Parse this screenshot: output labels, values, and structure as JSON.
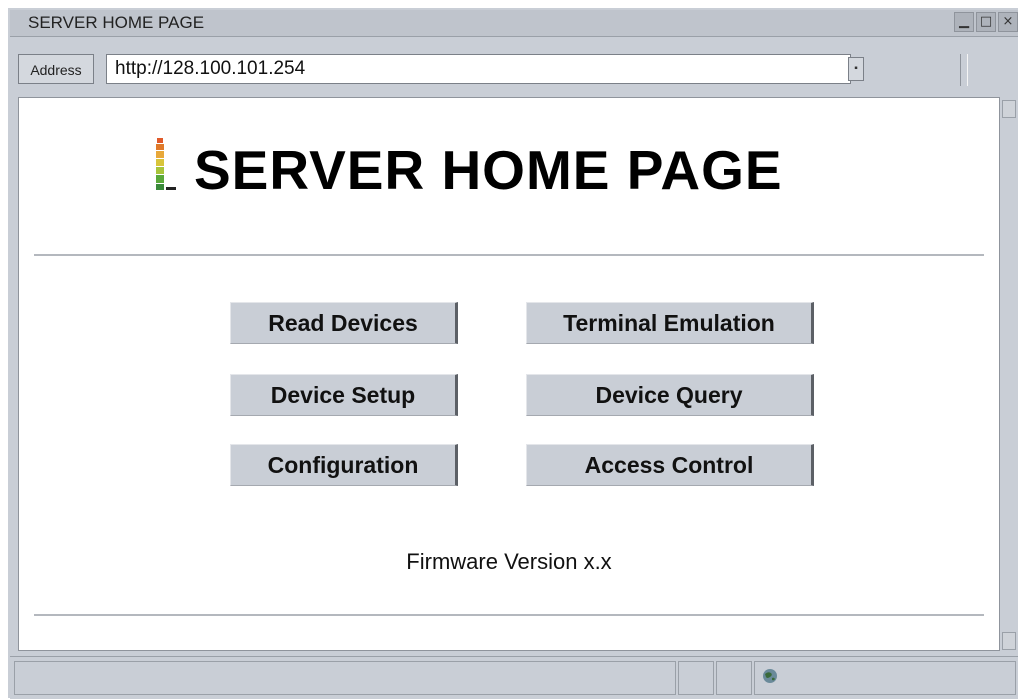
{
  "window": {
    "title": "SERVER HOME PAGE"
  },
  "address_bar": {
    "label": "Address",
    "url": "http://128.100.101.254"
  },
  "page": {
    "title": "SERVER HOME PAGE",
    "buttons": {
      "read_devices": "Read Devices",
      "terminal_emulation": "Terminal Emulation",
      "device_setup": "Device Setup",
      "device_query": "Device Query",
      "configuration": "Configuration",
      "access_control": "Access Control"
    },
    "firmware": "Firmware Version x.x"
  },
  "icons": {
    "logo": "signal-level-logo-icon",
    "status_zone": "globe-icon"
  }
}
